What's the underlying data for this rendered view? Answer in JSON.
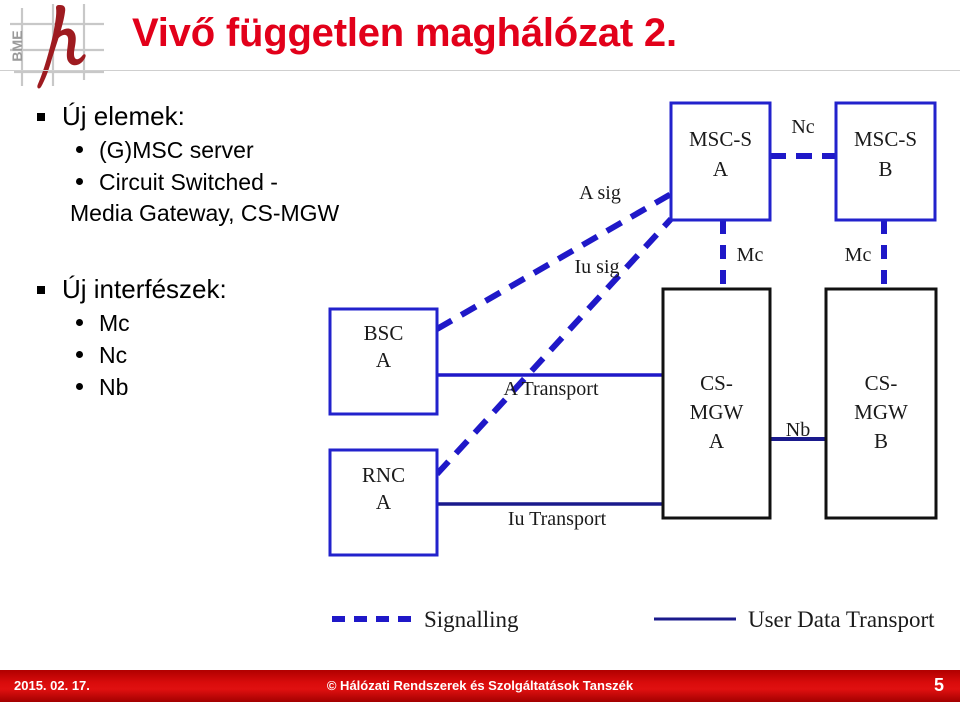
{
  "slide": {
    "title": "Vivő független maghálózat 2.",
    "title_color": "#e2001a",
    "logo_alt": "BME"
  },
  "content": {
    "groups": [
      {
        "heading": "Új elemek:",
        "items": [
          {
            "line1": "(G)MSC server",
            "line2": ""
          },
          {
            "line1": "Circuit Switched -",
            "line2": "Media Gateway, CS-MGW"
          }
        ]
      },
      {
        "heading": "Új interfészek:",
        "items": [
          {
            "line1": "Mc",
            "line2": ""
          },
          {
            "line1": "Nc",
            "line2": ""
          },
          {
            "line1": "Nb",
            "line2": ""
          }
        ]
      }
    ]
  },
  "diagram": {
    "colors": {
      "signalling": "#1f18c8",
      "transport": "#1a1a8c",
      "box_blue": "#2222cc",
      "box_dark": "#111111"
    },
    "nodes": [
      {
        "id": "msc-s-a",
        "line1": "MSC-S",
        "line2": "A",
        "border": "blue"
      },
      {
        "id": "msc-s-b",
        "line1": "MSC-S",
        "line2": "B",
        "border": "blue"
      },
      {
        "id": "bsc-a",
        "line1": "BSC",
        "line2": "A",
        "border": "blue"
      },
      {
        "id": "rnc-a",
        "line1": "RNC",
        "line2": "A",
        "border": "blue"
      },
      {
        "id": "cs-mgw-a",
        "line1": "CS-",
        "line2": "MGW",
        "line3": "A",
        "border": "dark"
      },
      {
        "id": "cs-mgw-b",
        "line1": "CS-",
        "line2": "MGW",
        "line3": "B",
        "border": "dark"
      }
    ],
    "edge_labels": {
      "nc": "Nc",
      "mc_left": "Mc",
      "mc_right": "Mc",
      "nb": "Nb",
      "a_sig": "A sig",
      "iu_sig": "Iu sig",
      "a_transport": "A Transport",
      "iu_transport": "Iu Transport"
    },
    "legend": [
      {
        "style": "dashed",
        "label": "Signalling"
      },
      {
        "style": "solid",
        "label": "User Data Transport"
      }
    ]
  },
  "footer": {
    "date": "2015. 02. 17.",
    "center": "© Hálózati Rendszerek és Szolgáltatások Tanszék",
    "page": "5",
    "bg_color": "#d00000"
  }
}
